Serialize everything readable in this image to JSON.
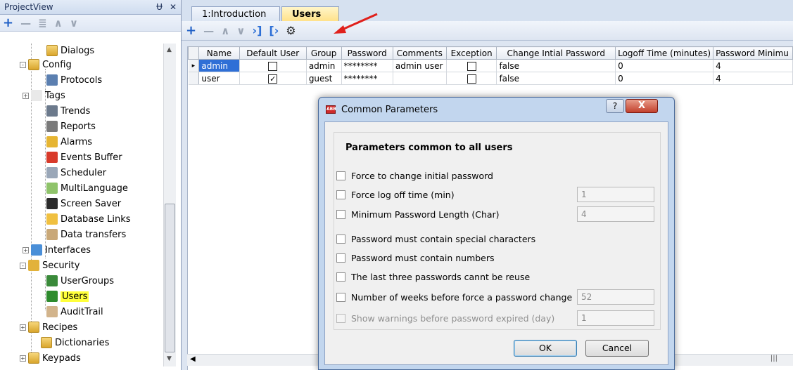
{
  "project_view": {
    "title": "ProjectView",
    "pin": "Ʉ",
    "close": "✕",
    "tree": [
      {
        "label": "Dialogs",
        "icon": "folder-icon"
      },
      {
        "label": "Config",
        "icon": "folder-icon"
      },
      {
        "label": "Protocols",
        "icon": "protocols-icon"
      },
      {
        "label": "Tags",
        "icon": "tags-icon"
      },
      {
        "label": "Trends",
        "icon": "trends-icon"
      },
      {
        "label": "Reports",
        "icon": "reports-icon"
      },
      {
        "label": "Alarms",
        "icon": "alarms-icon"
      },
      {
        "label": "Events Buffer",
        "icon": "events-buffer-icon"
      },
      {
        "label": "Scheduler",
        "icon": "scheduler-icon"
      },
      {
        "label": "MultiLanguage",
        "icon": "multilanguage-icon"
      },
      {
        "label": "Screen Saver",
        "icon": "screen-saver-icon"
      },
      {
        "label": "Database Links",
        "icon": "database-links-icon"
      },
      {
        "label": "Data transfers",
        "icon": "data-transfers-icon"
      },
      {
        "label": "Interfaces",
        "icon": "interfaces-icon"
      },
      {
        "label": "Security",
        "icon": "security-icon"
      },
      {
        "label": "UserGroups",
        "icon": "usergroups-icon"
      },
      {
        "label": "Users",
        "icon": "users-icon"
      },
      {
        "label": "AuditTrail",
        "icon": "audittrail-icon"
      },
      {
        "label": "Recipes",
        "icon": "folder-icon"
      },
      {
        "label": "Dictionaries",
        "icon": "folder-icon"
      },
      {
        "label": "Keypads",
        "icon": "folder-icon"
      }
    ]
  },
  "tabs": [
    {
      "label": "1:Introduction"
    },
    {
      "label": "Users"
    }
  ],
  "tab_close": "✕",
  "grid": {
    "columns": [
      "Name",
      "Default User",
      "Group",
      "Password",
      "Comments",
      "Exception",
      "Change Intial Password",
      "Logoff Time (minutes)",
      "Password Minimu"
    ],
    "rows": [
      {
        "name": "admin",
        "default_user": false,
        "group": "admin",
        "password": "********",
        "comments": "admin user",
        "exception": false,
        "change_initial_password": "false",
        "logoff_time": "0",
        "password_min": "4"
      },
      {
        "name": "user",
        "default_user": true,
        "group": "guest",
        "password": "********",
        "comments": "",
        "exception": false,
        "change_initial_password": "false",
        "logoff_time": "0",
        "password_min": "4"
      }
    ]
  },
  "dialog": {
    "title": "Common Parameters",
    "app_icon_text": "ABB",
    "help": "?",
    "close": "X",
    "group_title": "Parameters common to all users",
    "options": [
      {
        "label": "Force to change initial password",
        "checked": false,
        "enabled": true,
        "value": ""
      },
      {
        "label": "Force log off time (min)",
        "checked": false,
        "enabled": true,
        "value": "1"
      },
      {
        "label": "Minimum Password Length (Char)",
        "checked": false,
        "enabled": true,
        "value": "4"
      },
      {
        "label": "Password must contain special characters",
        "checked": false,
        "enabled": true,
        "value": ""
      },
      {
        "label": "Password must contain numbers",
        "checked": false,
        "enabled": true,
        "value": ""
      },
      {
        "label": "The last three passwords cannt be reuse",
        "checked": false,
        "enabled": true,
        "value": ""
      },
      {
        "label": "Number of weeks before force a password change",
        "checked": false,
        "enabled": true,
        "value": "52"
      },
      {
        "label": "Show warnings before password expired (day)",
        "checked": false,
        "enabled": false,
        "value": "1"
      }
    ],
    "ok_label": "OK",
    "cancel_label": "Cancel"
  },
  "colors": {
    "highlight": "#ffff3b",
    "selection": "#2f6fd6",
    "annotation_arrow": "#e0201b"
  }
}
